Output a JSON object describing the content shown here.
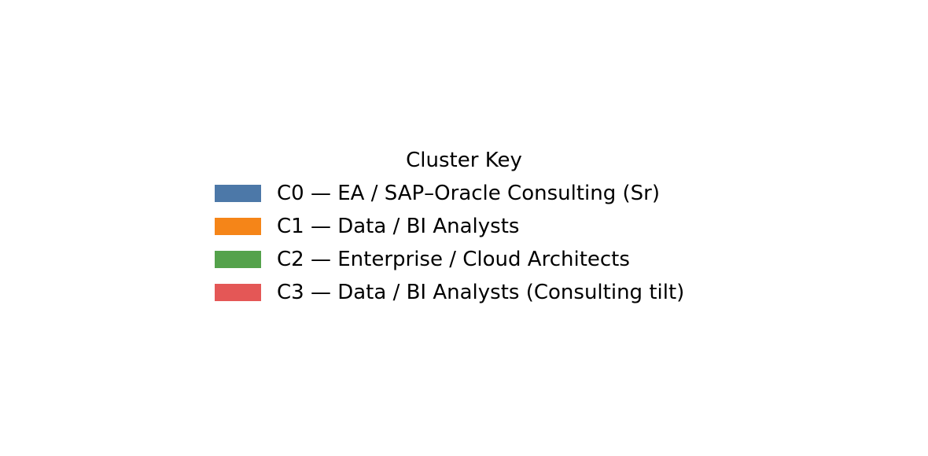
{
  "chart_data": {
    "type": "legend",
    "title": "Cluster Key",
    "entries": [
      {
        "label": "C0 — EA / SAP–Oracle Consulting (Sr)",
        "color": "#4c78a8"
      },
      {
        "label": "C1 — Data / BI Analysts",
        "color": "#f58518"
      },
      {
        "label": "C2 — Enterprise / Cloud Architects",
        "color": "#54a24b"
      },
      {
        "label": "C3 — Data / BI Analysts (Consulting tilt)",
        "color": "#e45756"
      }
    ]
  }
}
